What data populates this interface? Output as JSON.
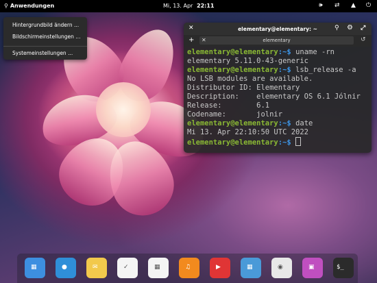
{
  "topbar": {
    "apps_label": "Anwendungen",
    "date": "Mi, 13. Apr",
    "time": "22:11",
    "indicators": [
      "volume-icon",
      "network-icon",
      "notifications-icon",
      "power-icon"
    ]
  },
  "context_menu": {
    "items": [
      "Hintergrundbild ändern ...",
      "Bildschirmeinstellungen ...",
      "Systemeinstellungen ..."
    ]
  },
  "terminal": {
    "window_title": "elementary@elementary: ~",
    "tab_label": "elementary",
    "lines": [
      {
        "prompt_user": "elementary@elementary",
        "prompt_path": ":~$ ",
        "command": "uname -rn"
      },
      {
        "output": "elementary 5.11.0-43-generic"
      },
      {
        "prompt_user": "elementary@elementary",
        "prompt_path": ":~$ ",
        "command": "lsb_release -a"
      },
      {
        "output": "No LSB modules are available."
      },
      {
        "output": "Distributor ID: Elementary"
      },
      {
        "output": "Description:    elementary OS 6.1 Jólnir"
      },
      {
        "output": "Release:        6.1"
      },
      {
        "output": "Codename:       jolnir"
      },
      {
        "prompt_user": "elementary@elementary",
        "prompt_path": ":~$ ",
        "command": "date"
      },
      {
        "output": "Mi 13. Apr 22:10:50 UTC 2022"
      },
      {
        "prompt_user": "elementary@elementary",
        "prompt_path": ":~$ ",
        "command": ""
      }
    ]
  },
  "dock": {
    "apps": [
      {
        "name": "multitasking-view",
        "icon": "multitasking-icon",
        "color": "#3d8fe0"
      },
      {
        "name": "web-browser",
        "icon": "globe-icon",
        "color": "#2f8fd8"
      },
      {
        "name": "mail",
        "icon": "mail-icon",
        "color": "#f2c94c"
      },
      {
        "name": "tasks",
        "icon": "tasks-icon",
        "color": "#f4f4f4"
      },
      {
        "name": "calendar",
        "icon": "calendar-icon",
        "color": "#f4f4f4"
      },
      {
        "name": "music",
        "icon": "music-icon",
        "color": "#f28a1e"
      },
      {
        "name": "videos",
        "icon": "video-icon",
        "color": "#e03535"
      },
      {
        "name": "photos",
        "icon": "photos-icon",
        "color": "#4a9ad8"
      },
      {
        "name": "system-settings",
        "icon": "toggle-icon",
        "color": "#e8e8e8"
      },
      {
        "name": "appcenter",
        "icon": "appcenter-icon",
        "color": "#c04fc0"
      },
      {
        "name": "terminal",
        "icon": "terminal-icon",
        "color": "#2b2b2b"
      }
    ],
    "terminal_label": "$_"
  }
}
